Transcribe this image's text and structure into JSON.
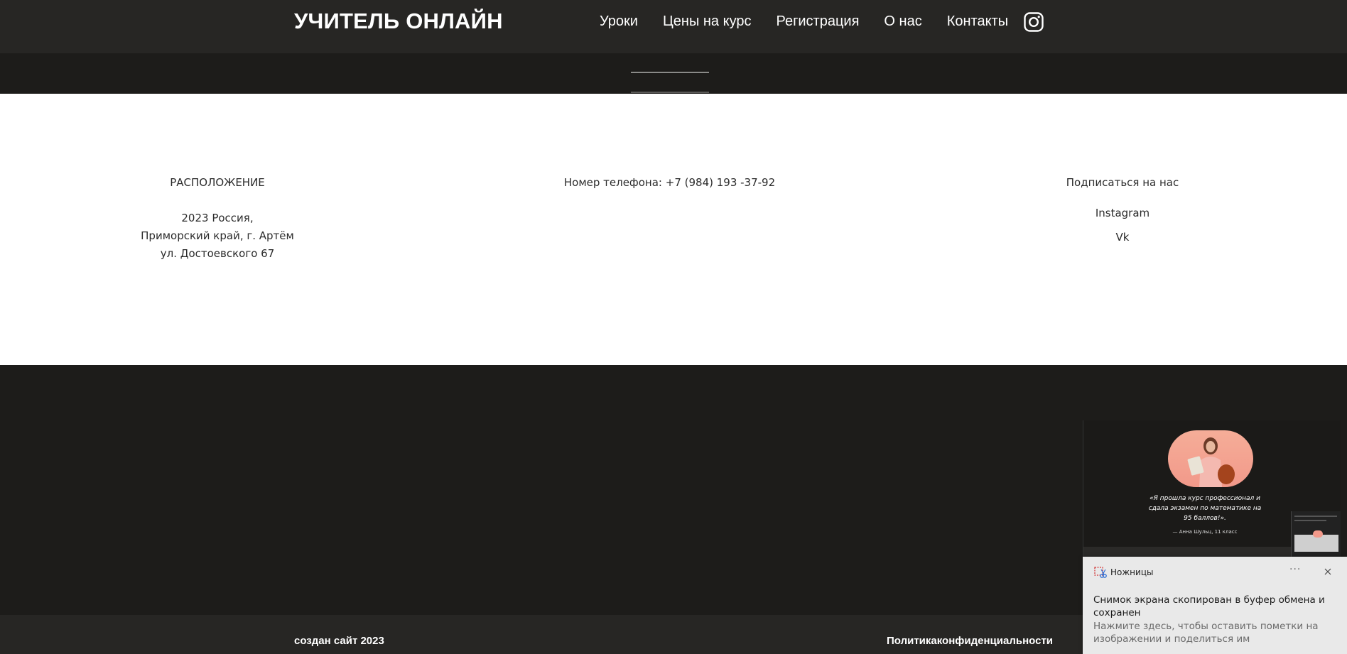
{
  "header": {
    "logo": "УЧИТЕЛЬ ОНЛАЙН",
    "nav": [
      "Уроки",
      "Цены на курс",
      "Регистрация",
      "О нас",
      "Контакты"
    ],
    "instagram_icon": "instagram-icon"
  },
  "info": {
    "location": {
      "heading": "РАСПОЛОЖЕНИЕ",
      "lines": [
        "2023 Россия,",
        "Приморский край, г. Артём",
        "ул. Достоевского 67"
      ]
    },
    "phone": "Номер телефона: +7 (984) 193 -37-92",
    "subscribe": {
      "heading": "Подписаться на нас",
      "links": [
        "Instagram",
        "Vk"
      ]
    }
  },
  "footer": {
    "left": "создан сайт 2023",
    "right": "Политикаконфиденциальности"
  },
  "thumbnail": {
    "quote": "«Я прошла курс профессионал и сдала экзамен по математике на 95 баллов!».",
    "author": "— Анна Шульц, 11 класс"
  },
  "toast": {
    "app_name": "Ножницы",
    "more": "···",
    "title": "Снимок экрана скопирован в буфер обмена и сохранен",
    "body": "Нажмите здесь, чтобы оставить пометки на изображении и поделиться им"
  },
  "colors": {
    "header_bg": "#272624",
    "dark_bg": "#1d1c1a",
    "info_bg": "#ffffff",
    "toast_bg": "#e9e9e9",
    "photo_bg": "#f5ad98"
  }
}
